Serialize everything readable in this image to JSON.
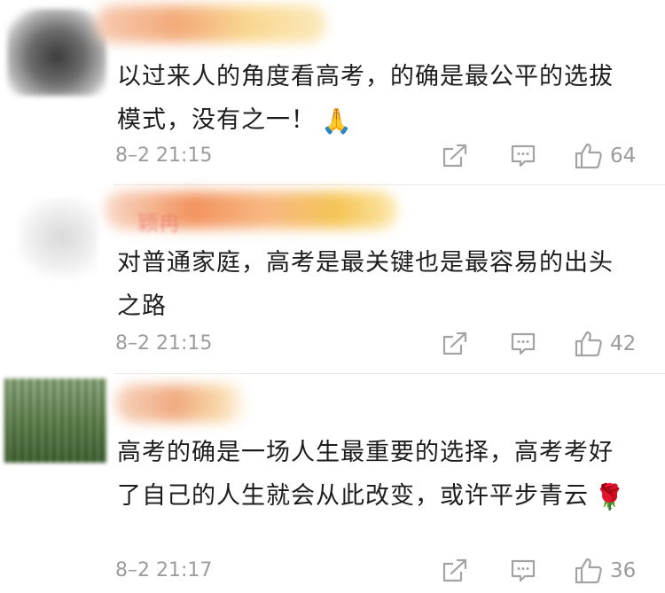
{
  "comments": [
    {
      "text": "以过来人的角度看高考，的确是最公平的选拔模式，没有之一！",
      "emoji": "🙏",
      "time": "8–2 21:15",
      "likes": "64"
    },
    {
      "name_partial": "颖冉",
      "text": "对普通家庭，高考是最关键也是最容易的出头之路",
      "time": "8–2 21:15",
      "likes": "42"
    },
    {
      "text": "高考的确是一场人生最重要的选择，高考考好了自己的人生就会从此改变，或许平步青云",
      "emoji": "🌹",
      "time": "8–2 21:17",
      "likes": "36"
    }
  ],
  "icons": [
    "share-icon",
    "comment-icon",
    "like-icon"
  ],
  "colors": {
    "meta_gray": "#9c9c9c",
    "divider": "#e9e9e9"
  }
}
